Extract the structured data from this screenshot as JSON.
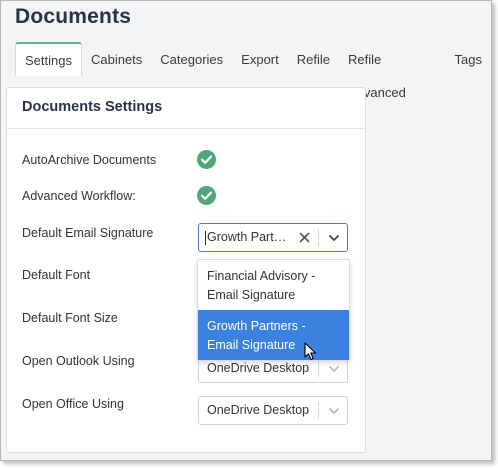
{
  "page": {
    "title": "Documents"
  },
  "tabs": [
    {
      "label": "Settings",
      "active": true
    },
    {
      "label": "Cabinets"
    },
    {
      "label": "Categories"
    },
    {
      "label": "Export"
    },
    {
      "label": "Refile"
    },
    {
      "label": "Refile Advanced"
    },
    {
      "label": "Tags"
    }
  ],
  "panel": {
    "title": "Documents Settings",
    "rows": {
      "auto_archive": {
        "label": "AutoArchive Documents",
        "checked": true
      },
      "advanced_workflow": {
        "label": "Advanced Workflow:",
        "checked": true
      },
      "email_signature": {
        "label": "Default Email Signature",
        "value": "Growth Partners - Email Signature"
      },
      "default_font": {
        "label": "Default Font"
      },
      "default_font_size": {
        "label": "Default Font Size"
      },
      "open_outlook": {
        "label": "Open Outlook Using",
        "value": "OneDrive Desktop"
      },
      "open_office": {
        "label": "Open Office Using",
        "value": "OneDrive Desktop"
      }
    }
  },
  "dropdown": {
    "options": [
      {
        "label": "Financial Advisory - Email Signature",
        "selected": false
      },
      {
        "label": "Growth Partners - Email Signature",
        "selected": true
      }
    ]
  },
  "colors": {
    "accent_green": "#4ea976",
    "selection_blue": "#3b82e0",
    "focus_border": "#4a7cc9",
    "title": "#263447"
  },
  "icons": [
    "check-circle-icon",
    "clear-icon",
    "chevron-down-icon",
    "mouse-pointer-icon"
  ]
}
